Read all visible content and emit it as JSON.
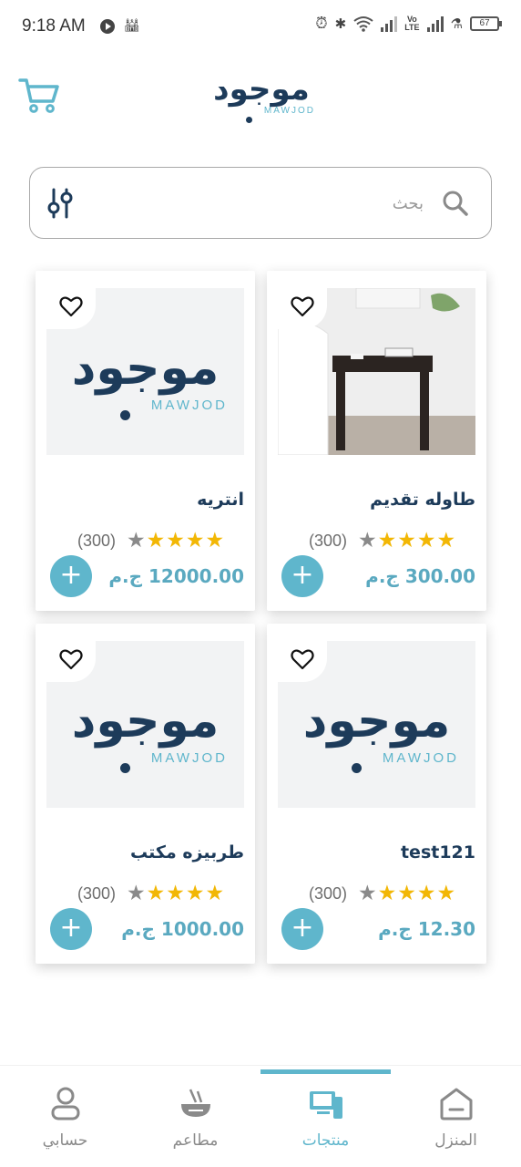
{
  "status_bar": {
    "time": "9:18 AM",
    "battery": "67",
    "volte": "Vo\nLTE"
  },
  "header": {
    "logo_arabic": "موجود",
    "logo_latin": "MAWJOD",
    "cart_icon": "cart-icon"
  },
  "search": {
    "placeholder": "بحث",
    "filter_icon": "filter-sliders-icon",
    "search_icon": "search-icon"
  },
  "products": [
    {
      "title": "طاوله تقديم",
      "price": "300.00 ج.م",
      "rating": 4,
      "count": "(300)",
      "image": "side-table-photo"
    },
    {
      "title": "انتريه",
      "price": "12000.00 ج.م",
      "rating": 4,
      "count": "(300)",
      "image": "logo-placeholder"
    },
    {
      "title": "test121",
      "price": "12.30 ج.م",
      "rating": 4,
      "count": "(300)",
      "image": "logo-placeholder"
    },
    {
      "title": "طربيزه مكتب",
      "price": "1000.00 ج.م",
      "rating": 4,
      "count": "(300)",
      "image": "logo-placeholder"
    }
  ],
  "add_label": "+",
  "bottom_nav": {
    "items": [
      {
        "label": "المنزل",
        "icon": "home-icon",
        "active": false
      },
      {
        "label": "منتجات",
        "icon": "products-icon",
        "active": true
      },
      {
        "label": "مطاعم",
        "icon": "restaurant-bowl-icon",
        "active": false
      },
      {
        "label": "حسابي",
        "icon": "user-icon",
        "active": false
      }
    ]
  },
  "colors": {
    "brand_navy": "#1d3b5a",
    "accent_teal": "#5fb6cc",
    "star": "#f2b705"
  }
}
